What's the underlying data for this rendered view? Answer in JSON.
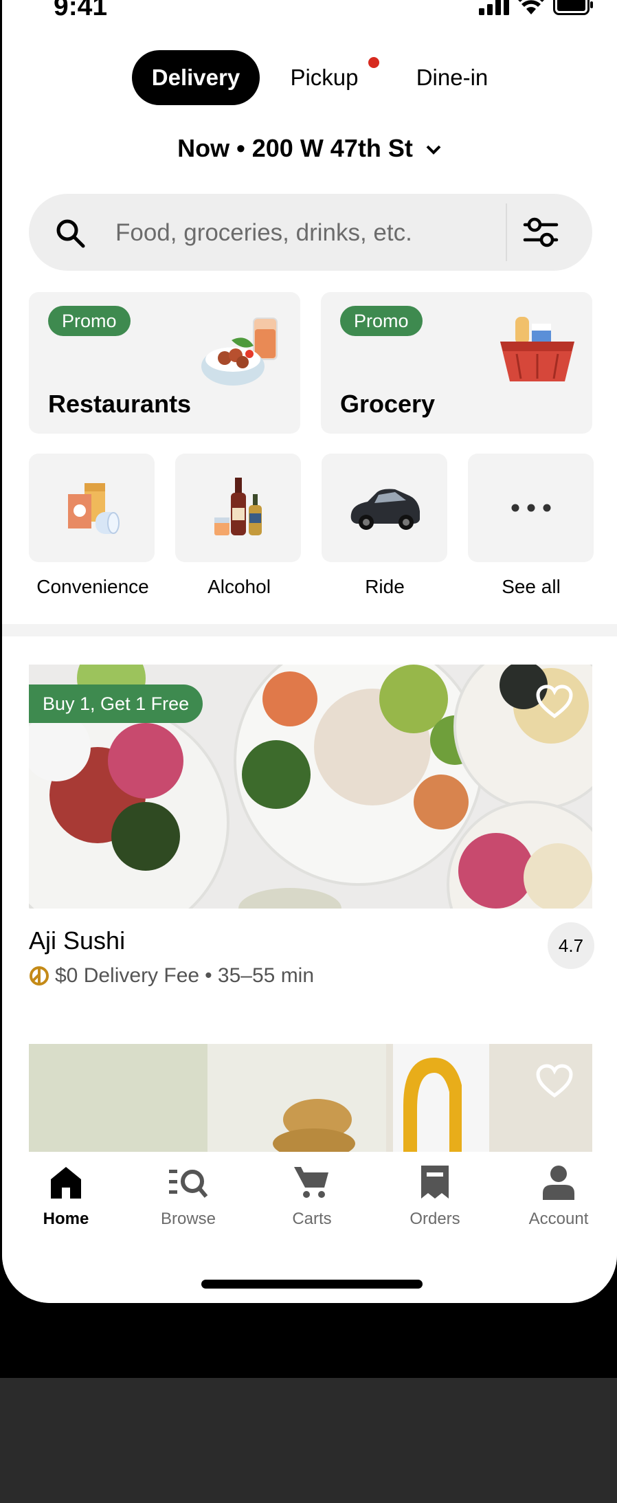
{
  "status_bar": {
    "time": "9:41"
  },
  "mode_tabs": [
    {
      "label": "Delivery",
      "active": true
    },
    {
      "label": "Pickup",
      "active": false,
      "has_dot": true
    },
    {
      "label": "Dine-in",
      "active": false
    }
  ],
  "address": {
    "text": "Now • 200 W 47th St"
  },
  "search": {
    "placeholder": "Food, groceries, drinks, etc."
  },
  "categories_large": [
    {
      "badge": "Promo",
      "label": "Restaurants"
    },
    {
      "badge": "Promo",
      "label": "Grocery"
    }
  ],
  "categories_small": [
    {
      "label": "Convenience"
    },
    {
      "label": "Alcohol"
    },
    {
      "label": "Ride"
    },
    {
      "label": "See all"
    }
  ],
  "restaurants": [
    {
      "deal": "Buy 1, Get 1 Free",
      "name": "Aji Sushi",
      "rating": "4.7",
      "delivery_fee": "$0 Delivery Fee",
      "eta": "• 35–55 min"
    }
  ],
  "bottom_nav": [
    {
      "label": "Home",
      "active": true
    },
    {
      "label": "Browse",
      "active": false
    },
    {
      "label": "Carts",
      "active": false
    },
    {
      "label": "Orders",
      "active": false
    },
    {
      "label": "Account",
      "active": false
    }
  ],
  "colors": {
    "promo_green": "#3e8a4f",
    "notification_red": "#d72a1f",
    "uber_one_gold": "#c48a17"
  }
}
